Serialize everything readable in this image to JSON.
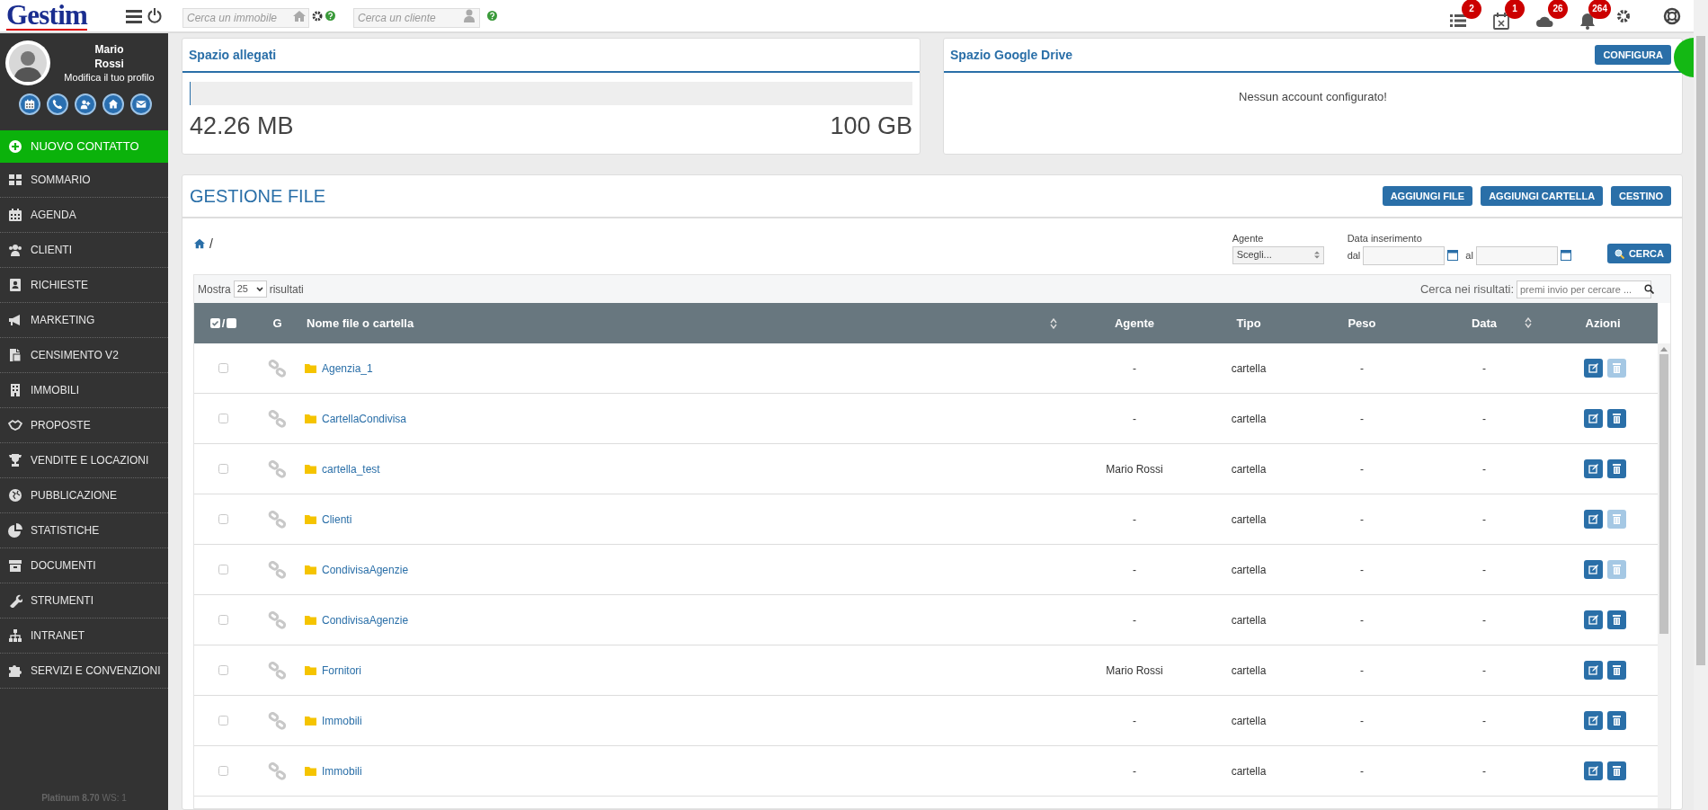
{
  "header": {
    "logo": "Gestim",
    "search_property": {
      "placeholder": "Cerca un immobile"
    },
    "search_client": {
      "placeholder": "Cerca un cliente"
    },
    "badges": [
      "2",
      "1",
      "26",
      "264"
    ]
  },
  "profile": {
    "first_name": "Mario",
    "last_name": "Rossi",
    "edit_link": "Modifica il tuo profilo"
  },
  "new_contact": "NUOVO CONTATTO",
  "sidebar": {
    "items": [
      "SOMMARIO",
      "AGENDA",
      "CLIENTI",
      "RICHIESTE",
      "MARKETING",
      "CENSIMENTO V2",
      "IMMOBILI",
      "PROPOSTE",
      "VENDITE E LOCAZIONI",
      "PUBBLICAZIONE",
      "STATISTICHE",
      "DOCUMENTI",
      "STRUMENTI",
      "INTRANET",
      "SERVIZI E CONVENZIONI"
    ]
  },
  "version": {
    "edition": "Platinum 8.70",
    "ws": "WS: 1"
  },
  "attachments_card": {
    "title": "Spazio allegati",
    "level": 0.0004,
    "used": "42.26 MB",
    "total": "100 GB"
  },
  "drive_card": {
    "title": "Spazio Google Drive",
    "button": "CONFIGURA",
    "message": "Nessun account configurato!"
  },
  "file_manager": {
    "title": "GESTIONE FILE",
    "buttons": [
      "AGGIUNGI FILE",
      "AGGIUNGI CARTELLA",
      "CESTINO"
    ],
    "breadcrumb": "/",
    "agent_filter": {
      "label": "Agente",
      "value": "Scegli..."
    },
    "date_filter": {
      "label": "Data inserimento",
      "from_label": "dal",
      "to_label": "al"
    },
    "search_button": "CERCA",
    "page_size": {
      "label_before": "Mostra",
      "value": "25",
      "label_after": "risultati"
    },
    "results_search": {
      "label": "Cerca nei risultati:",
      "placeholder": "premi invio per cercare ..."
    },
    "select_all_separator": "/",
    "columns": [
      {
        "label": "G",
        "sortable": false
      },
      {
        "label": "Nome file o cartella",
        "sortable": true
      },
      {
        "label": "Agente",
        "sortable": false
      },
      {
        "label": "Tipo",
        "sortable": false
      },
      {
        "label": "Peso",
        "sortable": false
      },
      {
        "label": "Data",
        "sortable": true
      },
      {
        "label": "Azioni",
        "sortable": false
      }
    ],
    "rows": [
      {
        "name": "Agenzia_1",
        "checked": false,
        "agent": "-",
        "type": "cartella",
        "size": "-",
        "date": "-",
        "delete_disabled": true
      },
      {
        "name": "CartellaCondivisa",
        "checked": false,
        "agent": "-",
        "type": "cartella",
        "size": "-",
        "date": "-",
        "delete_disabled": false
      },
      {
        "name": "cartella_test",
        "checked": false,
        "agent": "Mario Rossi",
        "type": "cartella",
        "size": "-",
        "date": "-",
        "delete_disabled": false
      },
      {
        "name": "Clienti",
        "checked": false,
        "agent": "-",
        "type": "cartella",
        "size": "-",
        "date": "-",
        "delete_disabled": true
      },
      {
        "name": "CondivisaAgenzie",
        "checked": false,
        "agent": "-",
        "type": "cartella",
        "size": "-",
        "date": "-",
        "delete_disabled": true
      },
      {
        "name": "CondivisaAgenzie",
        "checked": false,
        "agent": "-",
        "type": "cartella",
        "size": "-",
        "date": "-",
        "delete_disabled": false
      },
      {
        "name": "Fornitori",
        "checked": false,
        "agent": "Mario Rossi",
        "type": "cartella",
        "size": "-",
        "date": "-",
        "delete_disabled": false
      },
      {
        "name": "Immobili",
        "checked": false,
        "agent": "-",
        "type": "cartella",
        "size": "-",
        "date": "-",
        "delete_disabled": false
      },
      {
        "name": "Immobili",
        "checked": false,
        "agent": "-",
        "type": "cartella",
        "size": "-",
        "date": "-",
        "delete_disabled": false
      }
    ]
  }
}
